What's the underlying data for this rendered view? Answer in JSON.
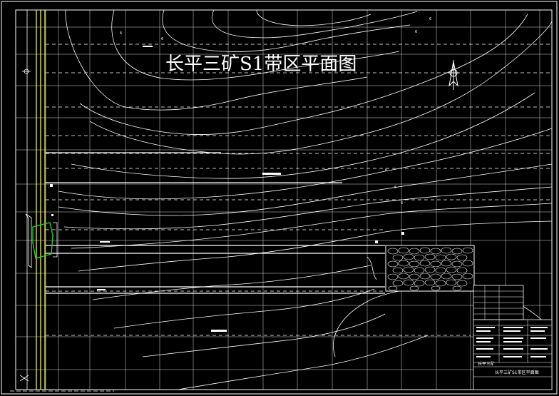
{
  "drawing": {
    "title": "长平三矿S1带区平面图",
    "title_block": {
      "company": "长平三矿",
      "caption": "长平三矿S1带区平面图"
    }
  },
  "colors": {
    "background": "#000000",
    "lines": "#ffffff",
    "border_road": "#ffff66",
    "green_feature": "#22cc22"
  },
  "icons": {
    "north_arrow": "north-arrow-icon",
    "coordinate_marker": "coordinate-marker-icon"
  }
}
